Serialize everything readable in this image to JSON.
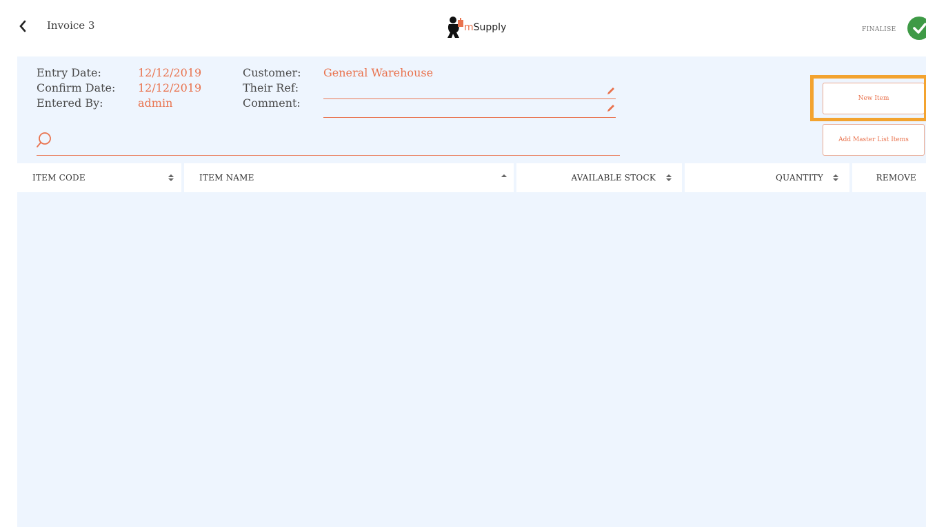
{
  "header": {
    "title": "Invoice 3",
    "logo_prefix": "m",
    "logo_text": "Supply",
    "finalise_label": "FINALISE"
  },
  "invoice": {
    "entry_date_label": "Entry Date:",
    "entry_date": "12/12/2019",
    "confirm_date_label": "Confirm Date:",
    "confirm_date": "12/12/2019",
    "entered_by_label": "Entered By:",
    "entered_by": "admin",
    "customer_label": "Customer:",
    "customer": "General Warehouse",
    "their_ref_label": "Their Ref:",
    "their_ref": "",
    "comment_label": "Comment:",
    "comment": ""
  },
  "search": {
    "value": "",
    "placeholder": ""
  },
  "buttons": {
    "new_item": "New Item",
    "add_master_list": "Add Master List Items"
  },
  "table": {
    "columns": [
      "ITEM CODE",
      "ITEM NAME",
      "AVAILABLE STOCK",
      "QUANTITY",
      "REMOVE"
    ],
    "rows": []
  },
  "colors": {
    "accent": "#e9724d",
    "background": "#eef5fe",
    "highlight": "#f3a32f",
    "success": "#3e9a46"
  }
}
